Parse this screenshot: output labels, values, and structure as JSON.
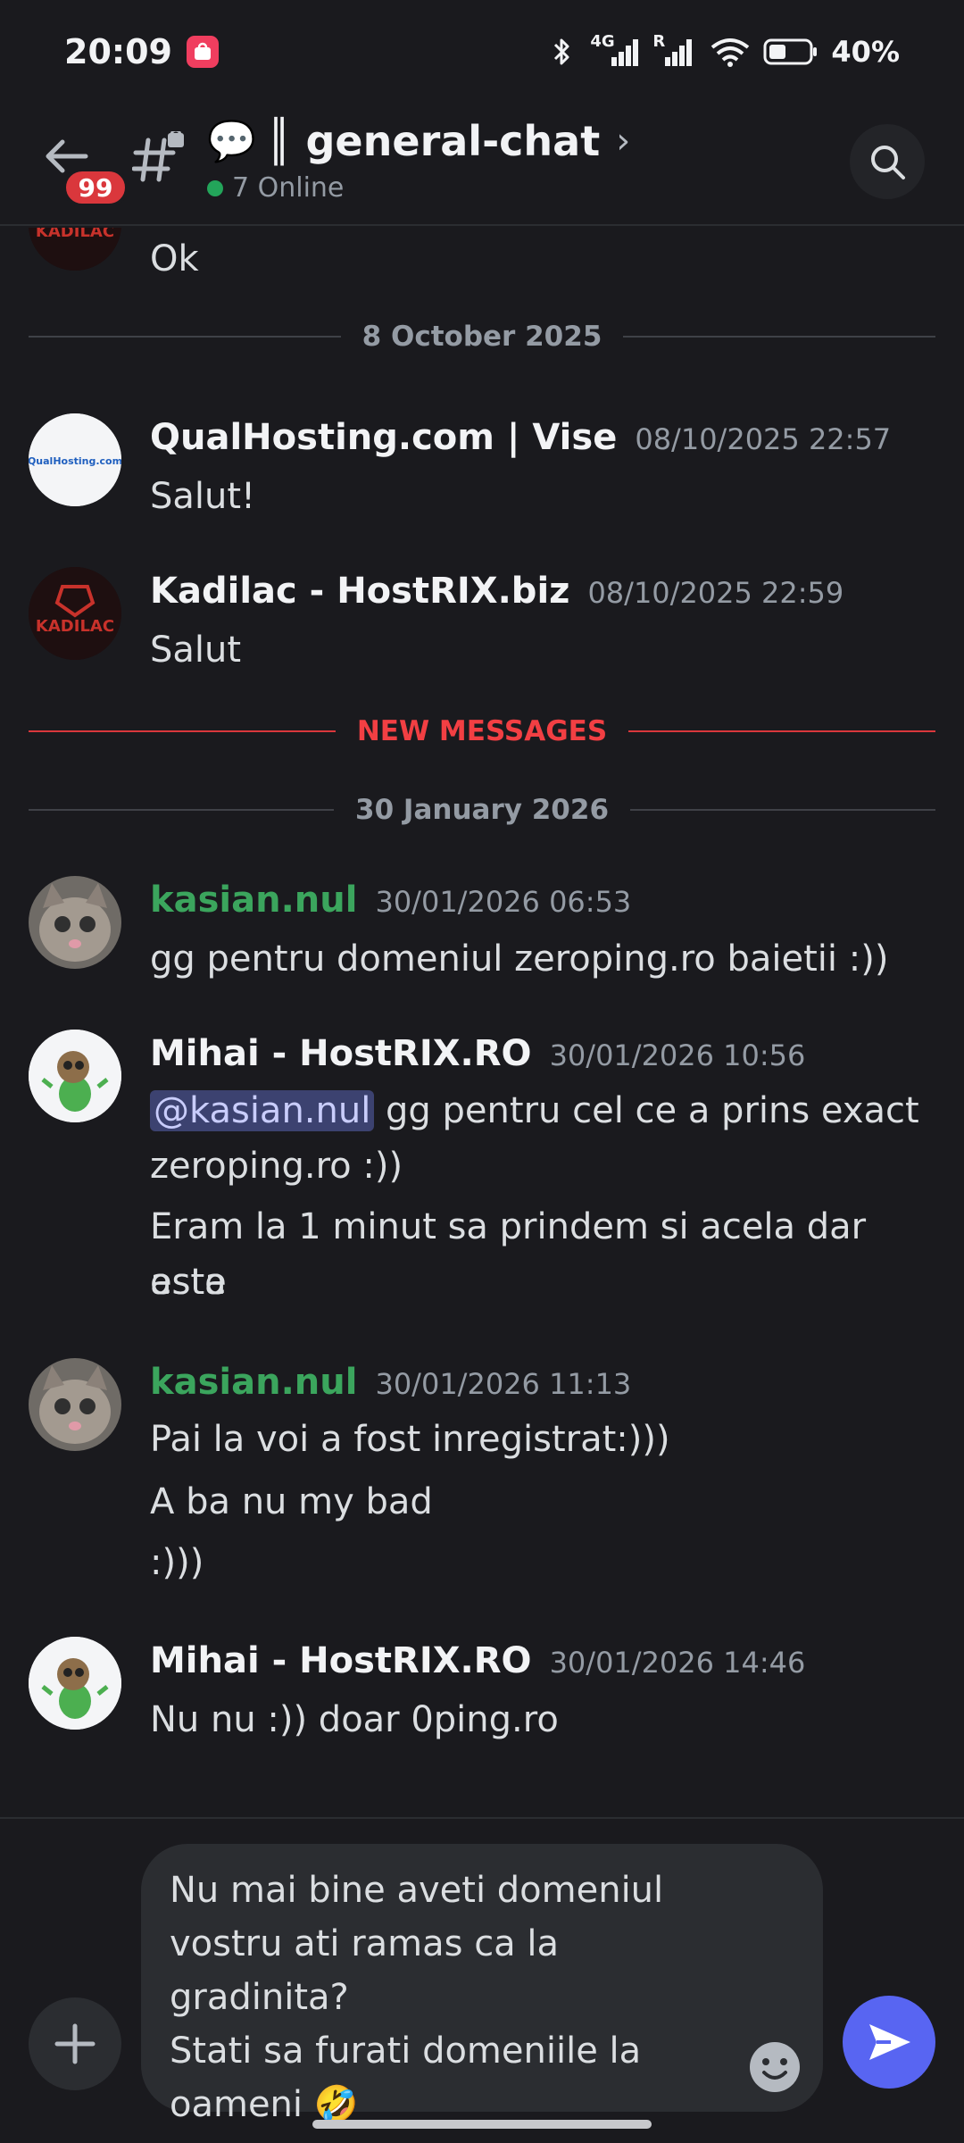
{
  "status_bar": {
    "time": "20:09",
    "battery": "40%",
    "net_label": "4G",
    "roaming": "R"
  },
  "header": {
    "badge_count": "99",
    "channel_emoji": "💬",
    "channel_name": "║ general-chat",
    "online_text": "7 Online"
  },
  "messages": {
    "prev_text": "Ok",
    "date1": "8 October 2025",
    "m1": {
      "author": "QualHosting.com | Vise",
      "timestamp": "08/10/2025 22:57",
      "text": "Salut!",
      "avatar_text": "QualHosting.com"
    },
    "m2": {
      "author": "Kadilac - HostRIX.biz",
      "timestamp": "08/10/2025 22:59",
      "text": "Salut",
      "avatar_text": "KADILAC"
    },
    "new_messages": "NEW MESSAGES",
    "date2": "30 January 2026",
    "m3": {
      "author": "kasian.nul",
      "timestamp": "30/01/2026 06:53",
      "text": "gg pentru domeniul zeroping.ro baietii :))"
    },
    "m4": {
      "author": "Mihai - HostRIX.RO",
      "timestamp": "30/01/2026 10:56",
      "mention": "@kasian.nul",
      "line1_rest": " gg pentru cel ce a prins exact",
      "line2": "zeroping.ro :))",
      "line3": "Eram la 1 minut sa prindem si acela dar asta",
      "line4": "este"
    },
    "m5": {
      "author": "kasian.nul",
      "timestamp": "30/01/2026 11:13",
      "line1": "Pai la voi a fost inregistrat:)))",
      "line2": "A ba nu my bad",
      "line3": ":)))"
    },
    "m6": {
      "author": "Mihai - HostRIX.RO",
      "timestamp": "30/01/2026 14:46",
      "text": "Nu nu :)) doar 0ping.ro"
    }
  },
  "composer": {
    "value": "Nu mai bine aveti domeniul\nvostru ati ramas ca la gradinita?\nStati sa furati domeniile la\noameni 🤣"
  },
  "colors": {
    "background": "#1a1a1e",
    "accent": "#5865f2",
    "green_author": "#3ba55d",
    "new_messages": "#f23f43",
    "badge": "#da373c"
  },
  "icons": [
    "back-arrow-icon",
    "channel-thread-icon",
    "search-icon",
    "plus-icon",
    "emoji-icon",
    "send-icon",
    "bluetooth-icon",
    "signal-icon",
    "wifi-icon",
    "battery-icon"
  ]
}
